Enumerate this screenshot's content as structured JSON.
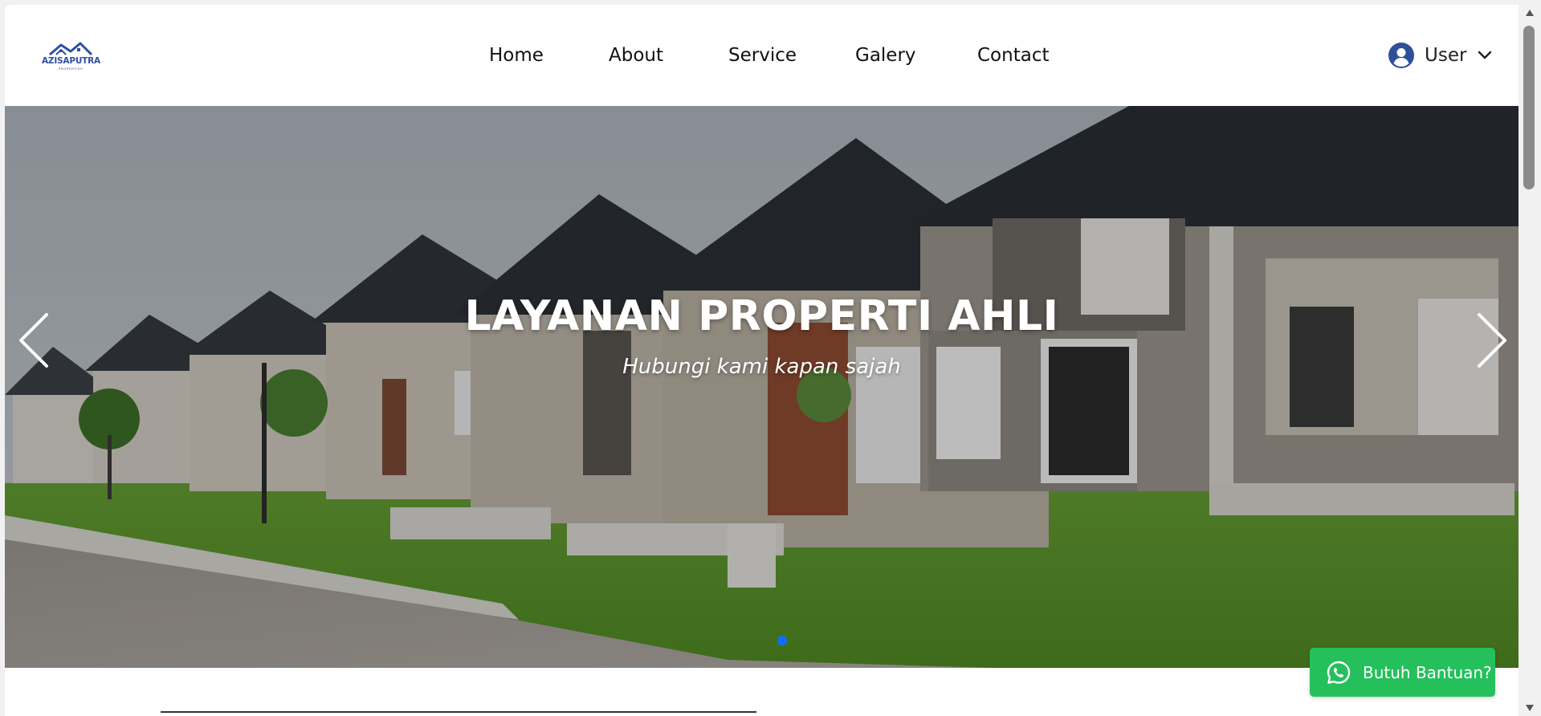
{
  "brand": {
    "name": "AZISAPUTRA",
    "tagline": "PROPERTIES"
  },
  "nav": {
    "home": "Home",
    "about": "About",
    "service": "Service",
    "galery": "Galery",
    "contact": "Contact"
  },
  "user_menu": {
    "label": "User",
    "icon": "user-circle-icon",
    "dropdown_icon": "chevron-down-icon"
  },
  "hero": {
    "title": "LAYANAN PROPERTI AHLI",
    "subtitle": "Hubungi kami kapan sajah",
    "slide_count": 1,
    "active_slide": 1
  },
  "help_button": {
    "label": "Butuh Bantuan?",
    "icon": "whatsapp-icon",
    "color": "#25c05c"
  },
  "colors": {
    "brand": "#2d4fa5",
    "accent": "#0d6efd"
  }
}
